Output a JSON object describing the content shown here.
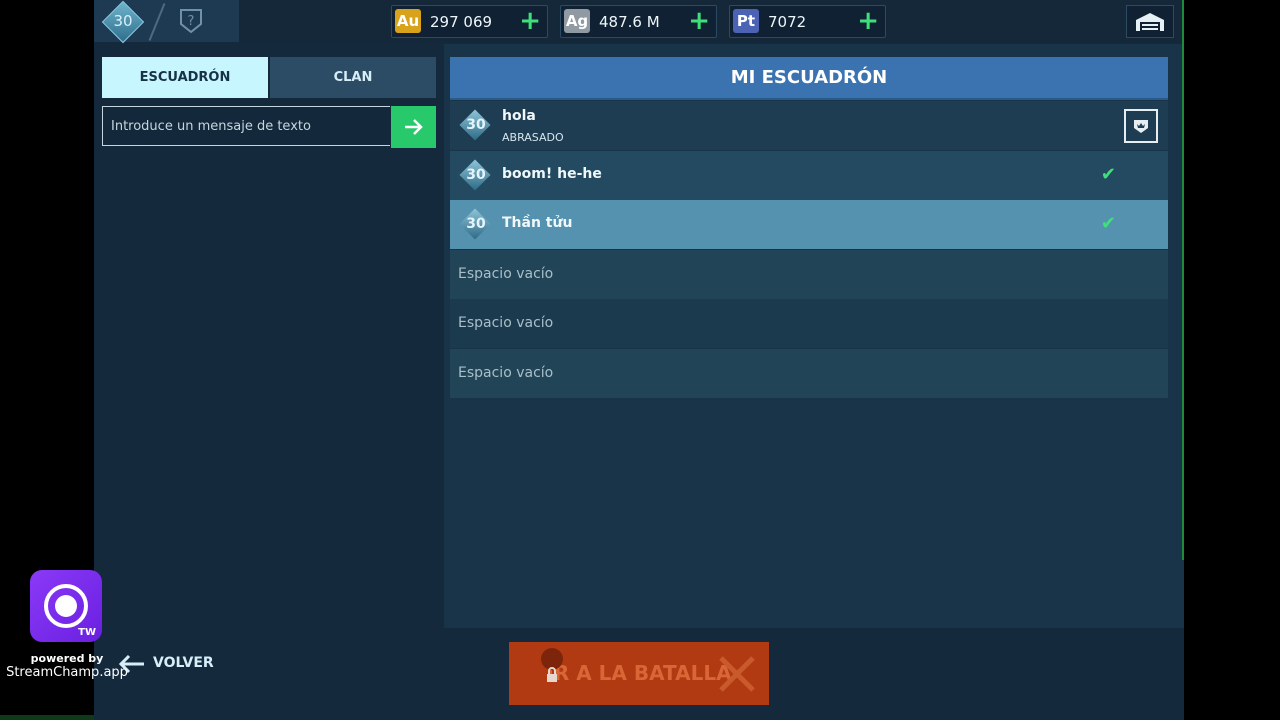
{
  "topbar": {
    "level": "30",
    "currencies": [
      {
        "code": "Au",
        "value": "297 069",
        "color": "#d8a21b"
      },
      {
        "code": "Ag",
        "value": "487.6 M",
        "color": "#8f9aa3"
      },
      {
        "code": "Pt",
        "value": "7072",
        "color": "#4c63b5"
      }
    ],
    "icons": {
      "rank": "question-shield-icon",
      "garage": "garage-icon"
    }
  },
  "tabs": {
    "squad": "ESCUADRÓN",
    "clan": "CLAN"
  },
  "chat": {
    "placeholder": "Introduce un mensaje de texto"
  },
  "squad": {
    "title": "MI ESCUADRÓN",
    "members": [
      {
        "level": "30",
        "name": "hola",
        "status": "ABRASADO",
        "leader": true
      },
      {
        "level": "30",
        "name": "boom! he-he",
        "ready": true
      },
      {
        "level": "30",
        "name": "Thần tửu",
        "ready": true,
        "selected": true
      }
    ],
    "empty_slots": [
      "Espacio vacío",
      "Espacio vacío",
      "Espacio vacío"
    ]
  },
  "bottom": {
    "battle": "IR A LA BATALLA",
    "back": "VOLVER"
  },
  "overlay": {
    "badge": "TW",
    "powered_by": "powered by",
    "brand": "StreamChamp.app"
  }
}
